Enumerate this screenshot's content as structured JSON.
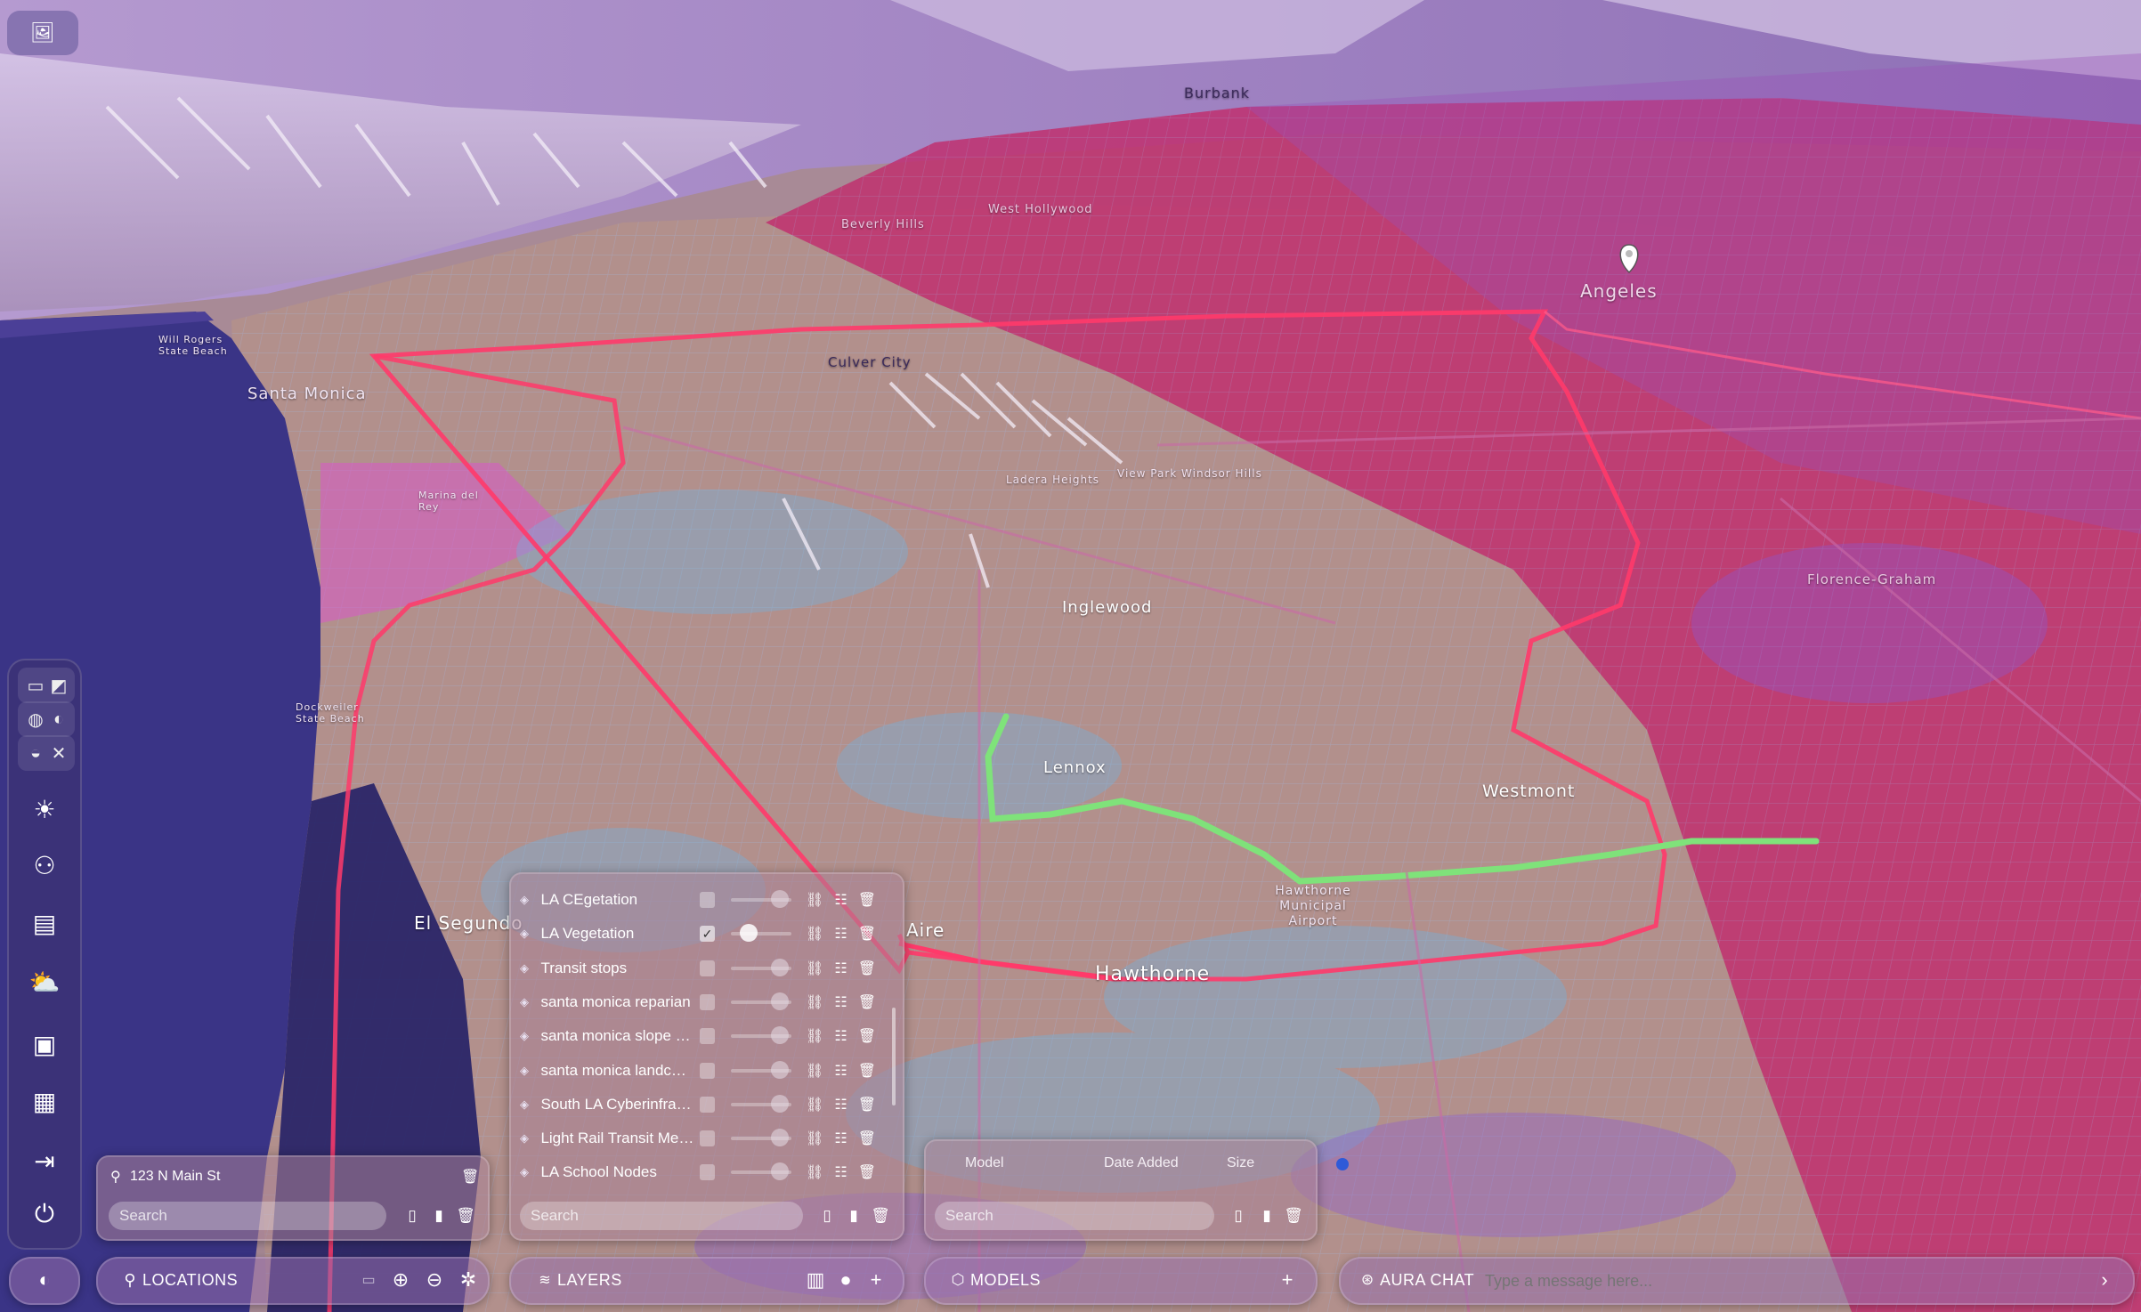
{
  "map": {
    "place_labels": [
      {
        "text": "Burbank",
        "size": "medium"
      },
      {
        "text": "West Hollywood",
        "size": "small"
      },
      {
        "text": "Beverly Hills",
        "size": "small"
      },
      {
        "text": "Angeles",
        "size": "large"
      },
      {
        "text": "Culver City",
        "size": "medium"
      },
      {
        "text": "Santa Monica",
        "size": "large"
      },
      {
        "text": "Ladera Heights",
        "size": "small"
      },
      {
        "text": "View Park Windsor Hills",
        "size": "small"
      },
      {
        "text": "Inglewood",
        "size": "large"
      },
      {
        "text": "Florence-Graham",
        "size": "medium"
      },
      {
        "text": "Lennox",
        "size": "large"
      },
      {
        "text": "Westmont",
        "size": "large"
      },
      {
        "text": "El Segundo",
        "size": "large"
      },
      {
        "text": "Hawthorne Municipal Airport",
        "size": "medium"
      },
      {
        "text": "Hawthorne",
        "size": "large"
      },
      {
        "text": "Aire",
        "size": "large"
      },
      {
        "text": "Dockweiler State Beach",
        "size": "small"
      },
      {
        "text": "Will Rogers State Beach",
        "size": "small"
      },
      {
        "text": "Marina del Rey",
        "size": "small"
      }
    ],
    "colors": {
      "ocean": "#3a3486",
      "land": "#b08a86",
      "zone": "#c0306e",
      "boundary_line": "#ff3a6a",
      "route_line": "#7fe27a",
      "marker": "#ffffff"
    }
  },
  "toolbar": {
    "items": [
      {
        "name": "globe-view",
        "icon": "globe-icon"
      },
      {
        "name": "sun",
        "icon": "sun-icon"
      },
      {
        "name": "binoculars",
        "icon": "binoculars-icon"
      },
      {
        "name": "chart-doc",
        "icon": "chart-document-icon"
      },
      {
        "name": "weather",
        "icon": "cloud-sun-icon"
      },
      {
        "name": "save",
        "icon": "floppy-disk-icon"
      },
      {
        "name": "dashboard",
        "icon": "grid-icon"
      },
      {
        "name": "export",
        "icon": "exit-icon"
      },
      {
        "name": "power",
        "icon": "power-icon"
      }
    ]
  },
  "locations_panel": {
    "saved_location": "123 N Main St",
    "search_placeholder": "Search"
  },
  "layers_panel": {
    "layers": [
      {
        "name": "LA CEgetation",
        "checked": false,
        "opacity": 0.9
      },
      {
        "name": "LA Vegetation",
        "checked": true,
        "opacity": 0.2
      },
      {
        "name": "Transit stops",
        "checked": false,
        "opacity": 0.9
      },
      {
        "name": "santa monica reparian",
        "checked": false,
        "opacity": 0.9
      },
      {
        "name": "santa monica slope de...",
        "checked": false,
        "opacity": 0.9
      },
      {
        "name": "santa monica landcover",
        "checked": false,
        "opacity": 0.9
      },
      {
        "name": "South LA Cyberinfrastr...",
        "checked": false,
        "opacity": 0.9
      },
      {
        "name": "Light Rail Transit Metr...",
        "checked": false,
        "opacity": 0.9
      },
      {
        "name": "LA School Nodes",
        "checked": false,
        "opacity": 0.9
      }
    ],
    "search_placeholder": "Search"
  },
  "models_panel": {
    "columns": [
      "Model",
      "Date Added",
      "Size"
    ],
    "search_placeholder": "Search"
  },
  "bottom_bar": {
    "locations_label": "LOCATIONS",
    "layers_label": "LAYERS",
    "models_label": "MODELS",
    "chat_label": "AURA CHAT",
    "chat_placeholder": "Type a message here..."
  }
}
